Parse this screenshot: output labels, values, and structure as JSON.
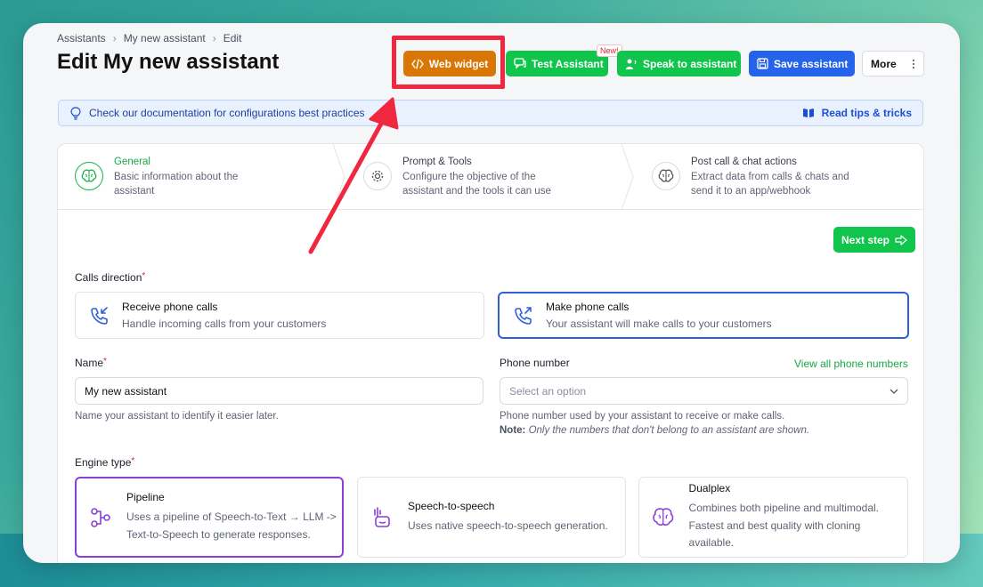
{
  "breadcrumb": [
    "Assistants",
    "My new assistant",
    "Edit"
  ],
  "page_title": "Edit My new assistant",
  "toolbar": {
    "web_widget": "Web widget",
    "test_assistant": "Test Assistant",
    "new_badge": "New!",
    "speak": "Speak to assistant",
    "save": "Save assistant",
    "more": "More"
  },
  "tip": {
    "text": "Check our documentation for configurations best practices",
    "link": "Read tips & tricks"
  },
  "steps": [
    {
      "title": "General",
      "desc": "Basic information about the assistant",
      "icon": "brain-icon"
    },
    {
      "title": "Prompt & Tools",
      "desc": "Configure the objective of the assistant and the tools it can use",
      "icon": "gear-icon"
    },
    {
      "title": "Post call & chat actions",
      "desc": "Extract data from calls & chats and send it to an app/webhook",
      "icon": "brain-icon"
    }
  ],
  "next_step": "Next step",
  "calls_direction": {
    "label": "Calls direction",
    "options": [
      {
        "title": "Receive phone calls",
        "desc": "Handle incoming calls from your customers"
      },
      {
        "title": "Make phone calls",
        "desc": "Your assistant will make calls to your customers"
      }
    ]
  },
  "name_field": {
    "label": "Name",
    "value": "My new assistant",
    "help": "Name your assistant to identify it easier later."
  },
  "phone_field": {
    "label": "Phone number",
    "link": "View all phone numbers",
    "placeholder": "Select an option",
    "help": "Phone number used by your assistant to receive or make calls.",
    "note_label": "Note:",
    "note": "Only the numbers that don't belong to an assistant are shown."
  },
  "engine": {
    "label": "Engine type",
    "options": [
      {
        "title": "Pipeline",
        "desc": "Uses a pipeline of Speech-to-Text → LLM -> Text-to-Speech to generate responses."
      },
      {
        "title": "Speech-to-speech",
        "desc": "Uses native speech-to-speech generation."
      },
      {
        "title": "Dualplex",
        "desc": "Combines both pipeline and multimodal. Fastest and best quality with cloning available."
      }
    ]
  },
  "colors": {
    "green": "#10c44c",
    "orange": "#d97706",
    "blue": "#2563eb",
    "highlight_red": "#f0283f",
    "purple": "#8b3fd6"
  }
}
